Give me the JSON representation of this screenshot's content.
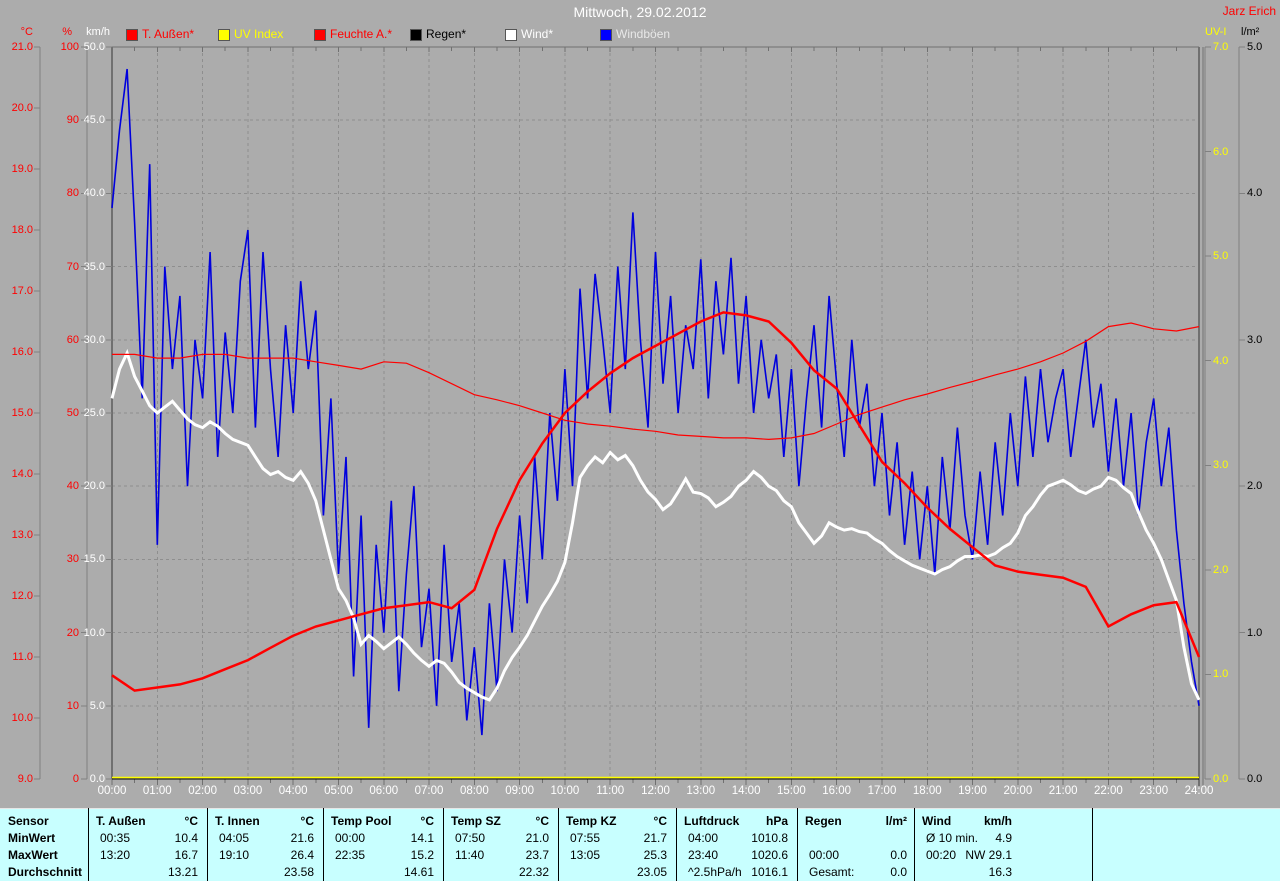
{
  "header": {
    "title": "Mittwoch, 29.02.2012",
    "author": "Jarz Erich"
  },
  "colors": {
    "background": "#acacac",
    "grid": "#8e8e8e",
    "frame": "#707070",
    "axis_line": "#808080",
    "table_bg": "#c8ffff",
    "white": "#ffffff",
    "red": "#ff0000",
    "yellow": "#ffff00",
    "blue": "#0000dd",
    "black": "#000000"
  },
  "legend": {
    "items": [
      {
        "label": "T. Außen*",
        "swatch": "#ff0000",
        "label_color": "#ff0000"
      },
      {
        "label": "UV Index",
        "swatch": "#ffff00",
        "label_color": "#ffff00"
      },
      {
        "label": "Feuchte A.*",
        "swatch": "#ff0000",
        "label_color": "#ff0000"
      },
      {
        "label": "Regen*",
        "swatch": "#000000",
        "label_color": "#000000"
      },
      {
        "label": "Wind*",
        "swatch": "#ffffff",
        "label_color": "#ffffff"
      },
      {
        "label": "Windböen",
        "swatch": "#0000ff",
        "label_color": "#e8e8e8"
      }
    ]
  },
  "axes": {
    "left": [
      {
        "header": "°C",
        "color": "#ff0000",
        "labels": [
          "21.0",
          "20.0",
          "19.0",
          "18.0",
          "17.0",
          "16.0",
          "15.0",
          "14.0",
          "13.0",
          "12.0",
          "11.0",
          "10.0",
          "9.0"
        ]
      },
      {
        "header": "%",
        "color": "#ff0000",
        "labels": [
          "100",
          "90",
          "80",
          "70",
          "60",
          "50",
          "40",
          "30",
          "20",
          "10",
          "0"
        ]
      },
      {
        "header": "km/h",
        "color": "#ffffff",
        "labels": [
          "50.0",
          "45.0",
          "40.0",
          "35.0",
          "30.0",
          "25.0",
          "20.0",
          "15.0",
          "10.0",
          "5.0",
          "0.0"
        ]
      }
    ],
    "right": [
      {
        "header": "UV-I",
        "color": "#ffff00",
        "labels": [
          "7.0",
          "6.0",
          "5.0",
          "4.0",
          "3.0",
          "2.0",
          "1.0",
          "0.0"
        ]
      },
      {
        "header": "l/m²",
        "color": "#000000",
        "labels": [
          "5.0",
          "4.0",
          "3.0",
          "2.0",
          "1.0",
          "0.0"
        ]
      }
    ],
    "x": {
      "labels": [
        "00:00",
        "01:00",
        "02:00",
        "03:00",
        "04:00",
        "05:00",
        "06:00",
        "07:00",
        "08:00",
        "09:00",
        "10:00",
        "11:00",
        "12:00",
        "13:00",
        "14:00",
        "15:00",
        "16:00",
        "17:00",
        "18:00",
        "19:00",
        "20:00",
        "21:00",
        "22:00",
        "23:00",
        "24:00"
      ]
    }
  },
  "chart_data": {
    "type": "line",
    "title": "Mittwoch, 29.02.2012",
    "x_unit": "hours",
    "x_range": [
      0,
      24
    ],
    "grid": true,
    "series": [
      {
        "name": "T. Außen",
        "unit": "°C",
        "color": "#ff0000",
        "width": 2.5,
        "axis": "temp",
        "axis_range": [
          9,
          21
        ],
        "interval_minutes": 30,
        "values": [
          10.7,
          10.45,
          10.5,
          10.55,
          10.65,
          10.8,
          10.95,
          11.15,
          11.35,
          11.5,
          11.6,
          11.7,
          11.8,
          11.85,
          11.9,
          11.8,
          12.1,
          13.1,
          13.9,
          14.5,
          15.0,
          15.35,
          15.65,
          15.9,
          16.1,
          16.3,
          16.5,
          16.65,
          16.6,
          16.5,
          16.15,
          15.7,
          15.4,
          14.8,
          14.2,
          13.85,
          13.45,
          13.1,
          12.8,
          12.5,
          12.4,
          12.35,
          12.3,
          12.15,
          11.5,
          11.7,
          11.85,
          11.9,
          11.0
        ]
      },
      {
        "name": "UV Index",
        "unit": "UV-I",
        "color": "#ffff00",
        "width": 1.5,
        "axis": "uv",
        "axis_range": [
          0,
          7
        ],
        "interval_minutes": 1440,
        "y_offset": -1.5,
        "values": [
          0,
          0
        ]
      },
      {
        "name": "Feuchte A.",
        "unit": "%",
        "color": "#ff0000",
        "width": 1.2,
        "axis": "humidity",
        "axis_range": [
          0,
          100
        ],
        "interval_minutes": 30,
        "values": [
          58,
          58,
          57.5,
          57.5,
          58,
          58,
          57.5,
          57.5,
          57.5,
          57,
          56.5,
          56,
          57,
          56.8,
          55.5,
          54,
          52.5,
          51.8,
          51,
          50,
          49,
          48.5,
          48.2,
          47.8,
          47.5,
          47,
          46.8,
          46.6,
          46.6,
          46.4,
          46.6,
          47.2,
          48.5,
          49.8,
          50.8,
          51.8,
          52.6,
          53.5,
          54.3,
          55.2,
          56,
          57,
          58.2,
          59.8,
          61.8,
          62.3,
          61.5,
          61.2,
          61.8
        ]
      },
      {
        "name": "Regen",
        "unit": "l/m²",
        "color": "#000000",
        "width": 1,
        "axis": "rain",
        "axis_range": [
          0,
          5
        ],
        "interval_minutes": 1440,
        "values": [
          0,
          0
        ]
      },
      {
        "name": "Wind",
        "unit": "km/h",
        "color": "#ffffff",
        "width": 3,
        "axis": "wind",
        "axis_range": [
          0,
          50
        ],
        "interval_minutes": 10,
        "values": [
          26.0,
          28.0,
          29.1,
          27.5,
          26.5,
          25.5,
          25.0,
          25.4,
          25.8,
          25.2,
          24.6,
          24.2,
          24.0,
          24.4,
          24.1,
          23.6,
          23.2,
          23.0,
          22.8,
          22.0,
          21.2,
          20.8,
          21.0,
          20.6,
          20.4,
          21.0,
          20.2,
          19.0,
          17.0,
          15.0,
          13.0,
          12.2,
          11.0,
          9.2,
          9.8,
          9.4,
          8.9,
          9.3,
          9.7,
          9.2,
          8.6,
          8.1,
          7.7,
          8.1,
          7.9,
          7.3,
          6.6,
          6.2,
          5.9,
          5.6,
          5.4,
          6.2,
          7.4,
          8.3,
          9.0,
          9.8,
          10.8,
          11.8,
          12.6,
          13.5,
          14.8,
          17.5,
          20.6,
          21.4,
          22.0,
          21.6,
          22.3,
          21.8,
          22.1,
          21.4,
          20.4,
          19.6,
          19.1,
          18.4,
          18.8,
          19.6,
          20.5,
          19.6,
          19.5,
          19.2,
          18.6,
          18.9,
          19.3,
          20.0,
          20.4,
          21.0,
          20.6,
          20.0,
          19.7,
          19.0,
          18.6,
          17.5,
          16.8,
          16.1,
          16.6,
          17.5,
          17.2,
          17.0,
          17.1,
          16.9,
          16.8,
          16.4,
          16.1,
          15.6,
          15.2,
          14.9,
          14.6,
          14.4,
          14.2,
          14.0,
          14.3,
          14.5,
          14.9,
          15.2,
          15.2,
          15.3,
          15.2,
          15.4,
          15.8,
          16.1,
          16.8,
          18.0,
          18.6,
          19.4,
          20.0,
          20.2,
          20.4,
          20.1,
          19.7,
          19.5,
          19.8,
          20.0,
          20.6,
          20.4,
          19.9,
          19.5,
          18.2,
          17.0,
          16.1,
          15.0,
          13.6,
          12.2,
          9.0,
          6.5,
          5.4
        ]
      },
      {
        "name": "Windböen",
        "unit": "km/h",
        "color": "#0000dd",
        "width": 1.6,
        "axis": "wind",
        "axis_range": [
          0,
          50
        ],
        "interval_minutes": 10,
        "values": [
          39.0,
          44.3,
          48.5,
          38.0,
          26.0,
          42.0,
          16.0,
          35.0,
          28.0,
          33.0,
          20.0,
          30.0,
          26.0,
          36.0,
          22.0,
          30.5,
          25.0,
          34.0,
          37.5,
          24.0,
          36.0,
          28.0,
          22.0,
          31.0,
          25.0,
          34.0,
          28.0,
          32.0,
          18.0,
          26.0,
          14.0,
          22.0,
          7.0,
          18.0,
          3.5,
          16.0,
          10.0,
          19.0,
          6.0,
          14.0,
          20.0,
          9.0,
          13.0,
          5.0,
          16.0,
          8.0,
          12.0,
          4.0,
          9.0,
          3.0,
          12.0,
          6.0,
          15.0,
          10.0,
          18.0,
          12.0,
          22.0,
          15.0,
          25.0,
          19.0,
          28.0,
          20.0,
          33.5,
          26.0,
          34.5,
          30.0,
          25.0,
          35.0,
          28.0,
          38.7,
          30.0,
          24.0,
          36.0,
          27.0,
          33.0,
          25.0,
          31.0,
          28.0,
          35.5,
          26.0,
          34.0,
          29.0,
          35.6,
          27.0,
          33.0,
          25.0,
          30.0,
          26.0,
          29.0,
          22.0,
          28.0,
          20.0,
          26.0,
          31.0,
          24.0,
          33.0,
          27.0,
          22.0,
          30.0,
          24.0,
          27.0,
          20.0,
          25.0,
          18.0,
          23.0,
          16.0,
          21.0,
          15.0,
          20.0,
          14.0,
          22.0,
          17.0,
          24.0,
          18.0,
          15.0,
          21.0,
          16.0,
          23.0,
          18.0,
          25.0,
          20.0,
          27.5,
          22.0,
          28.0,
          23.0,
          26.0,
          28.0,
          22.0,
          26.0,
          30.0,
          24.0,
          27.0,
          21.0,
          26.0,
          20.0,
          25.0,
          18.0,
          23.0,
          26.0,
          20.0,
          24.0,
          17.0,
          12.0,
          8.0,
          5.0
        ]
      }
    ]
  },
  "table": {
    "row_labels": [
      "Sensor",
      "MinWert",
      "MaxWert",
      "Durchschnitt"
    ],
    "groups": [
      {
        "name": "T. Außen",
        "unit": "°C",
        "rows": [
          [
            "00:35",
            "10.4"
          ],
          [
            "13:20",
            "16.7"
          ],
          [
            "",
            "13.21"
          ]
        ]
      },
      {
        "name": "T. Innen",
        "unit": "°C",
        "rows": [
          [
            "04:05",
            "21.6"
          ],
          [
            "19:10",
            "26.4"
          ],
          [
            "",
            "23.58"
          ]
        ]
      },
      {
        "name": "Temp Pool",
        "unit": "°C",
        "rows": [
          [
            "00:00",
            "14.1"
          ],
          [
            "22:35",
            "15.2"
          ],
          [
            "",
            "14.61"
          ]
        ]
      },
      {
        "name": "Temp SZ",
        "unit": "°C",
        "rows": [
          [
            "07:50",
            "21.0"
          ],
          [
            "11:40",
            "23.7"
          ],
          [
            "",
            "22.32"
          ]
        ]
      },
      {
        "name": "Temp KZ",
        "unit": "°C",
        "rows": [
          [
            "07:55",
            "21.7"
          ],
          [
            "13:05",
            "25.3"
          ],
          [
            "",
            "23.05"
          ]
        ]
      },
      {
        "name": "Luftdruck",
        "unit": "hPa",
        "rows": [
          [
            "04:00",
            "1010.8"
          ],
          [
            "23:40",
            "1020.6"
          ],
          [
            "^2.5hPa/h",
            "1016.1"
          ]
        ]
      },
      {
        "name": "Regen",
        "unit": "l/m²",
        "rows": [
          [
            "",
            ""
          ],
          [
            "00:00",
            "0.0"
          ],
          [
            "Gesamt:",
            "0.0"
          ]
        ]
      },
      {
        "name": "Wind",
        "unit": "km/h",
        "rows": [
          [
            "Ø 10 min.",
            "4.9"
          ],
          [
            "00:20",
            "NW 29.1"
          ],
          [
            "",
            "16.3"
          ]
        ]
      }
    ]
  }
}
